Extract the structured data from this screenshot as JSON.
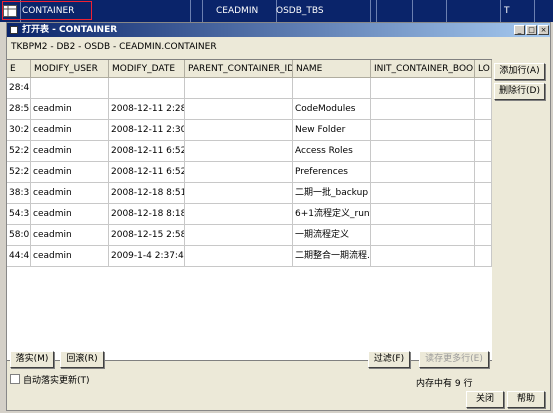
{
  "background_row": {
    "cells": [
      "CONTAINER",
      "CEADMIN",
      "OSDB_TBS",
      "T"
    ]
  },
  "dialog": {
    "title": "打开表  -  CONTAINER",
    "path": "TKBPM2 - DB2 - OSDB - CEADMIN.CONTAINER",
    "columns": [
      "E",
      "MODIFY_USER",
      "MODIFY_DATE",
      "PARENT_CONTAINER_ID",
      "NAME",
      "INIT_CONTAINER_BOOL",
      "LO"
    ],
    "rows": [
      [
        "28:4...",
        "",
        "",
        "",
        "",
        "",
        ""
      ],
      [
        "28:5...",
        "ceadmin",
        "2008-12-11 2:28:5...",
        "",
        "CodeModules",
        "",
        ""
      ],
      [
        "30:2...",
        "ceadmin",
        "2008-12-11 2:30:2...",
        "",
        "New Folder",
        "",
        ""
      ],
      [
        "52:2...",
        "ceadmin",
        "2008-12-11 6:52:2...",
        "",
        "Access Roles",
        "",
        ""
      ],
      [
        "52:2...",
        "ceadmin",
        "2008-12-11 6:52:2...",
        "",
        "Preferences",
        "",
        ""
      ],
      [
        "38:3...",
        "ceadmin",
        "2008-12-18 8:51:2...",
        "",
        "二期一批_backup",
        "",
        ""
      ],
      [
        "54:3...",
        "ceadmin",
        "2008-12-18 8:18:3...",
        "",
        "6+1流程定义_runti...",
        "",
        ""
      ],
      [
        "58:0...",
        "ceadmin",
        "2008-12-15 2:58:0...",
        "",
        "一期流程定义",
        "",
        ""
      ],
      [
        "44:4...",
        "ceadmin",
        "2009-1-4 2:37:44 4...",
        "",
        "二期整合一期流程...",
        "",
        ""
      ]
    ],
    "buttons": {
      "add_row": "添加行(A)",
      "delete_row": "删除行(D)",
      "commit": "落实(M)",
      "rollback": "回滚(R)",
      "filter": "过滤(F)",
      "load_more": "读存更多行(E)",
      "close": "关闭",
      "help": "帮助"
    },
    "auto_commit_label": "自动落实更新(T)",
    "auto_commit_checked": false,
    "memory_status": "内存中有 9 行"
  }
}
